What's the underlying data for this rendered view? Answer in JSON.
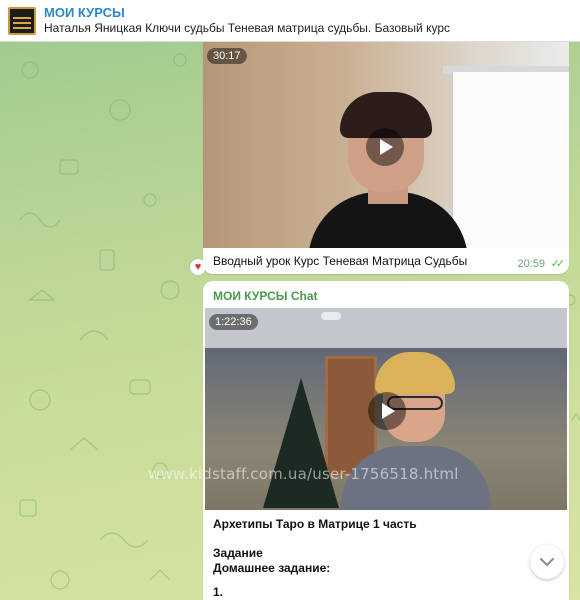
{
  "header": {
    "channel_name": "МОИ КУРСЫ",
    "pinned_text": "Наталья Яницкая Ключи судьбы Теневая матрица судьбы. Базовый курс"
  },
  "messages": [
    {
      "video_duration": "30:17",
      "caption": "Вводный урок Курс Теневая Матрица Судьбы",
      "time": "20:59",
      "reaction": "heart"
    },
    {
      "sender": "МОИ КУРСЫ Chat",
      "video_duration": "1:22:36",
      "caption_title": "Архетипы Таро в Матрице 1 часть",
      "caption_line2": "Задание",
      "caption_line3": "Домашнее задание:",
      "caption_line4": "1."
    }
  ],
  "watermark": "www.kidstaff.com.ua/user-1756518.html",
  "colors": {
    "channel_accent": "#2b88c7",
    "sender_accent": "#4a9a4c",
    "reaction": "#e0303c",
    "read_checks": "#5fb05a"
  },
  "icons": [
    "play-icon",
    "heart-icon",
    "double-check-icon",
    "chevron-down-icon"
  ]
}
